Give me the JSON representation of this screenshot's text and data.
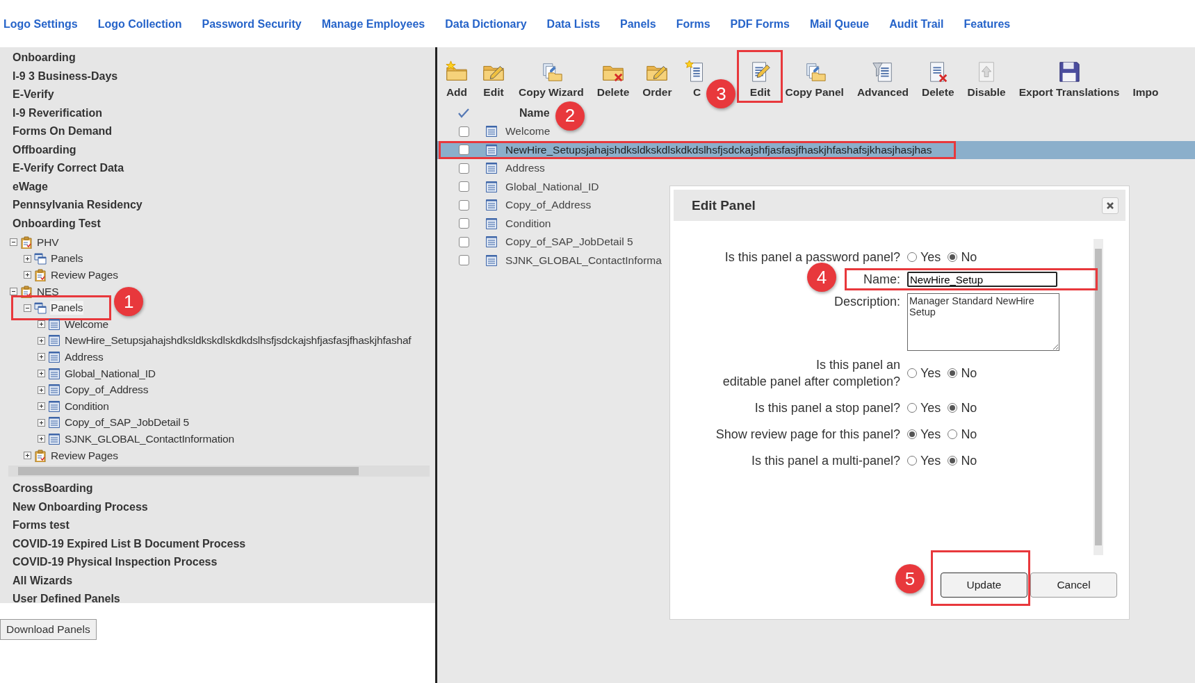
{
  "nav": [
    "Logo Settings",
    "Logo Collection",
    "Password Security",
    "Manage Employees",
    "Data Dictionary",
    "Data Lists",
    "Panels",
    "Forms",
    "PDF Forms",
    "Mail Queue",
    "Audit Trail",
    "Features"
  ],
  "sidebar": {
    "sections_top": [
      "Onboarding",
      "I-9 3 Business-Days",
      "E-Verify",
      "I-9 Reverification",
      "Forms On Demand",
      "Offboarding",
      "E-Verify Correct Data",
      "eWage",
      "Pennsylvania Residency",
      "Onboarding Test"
    ],
    "tree": [
      {
        "label": "PHV",
        "kind": "clipboard",
        "expanded": true,
        "selected": false,
        "children": [
          {
            "label": "Panels",
            "kind": "windows",
            "expanded": false,
            "selected": false
          },
          {
            "label": "Review Pages",
            "kind": "clipboard",
            "expanded": false,
            "selected": false
          }
        ]
      },
      {
        "label": "NES",
        "kind": "clipboard",
        "expanded": true,
        "selected": false,
        "children": [
          {
            "label": "Panels",
            "kind": "windows",
            "expanded": true,
            "selected": true,
            "callout": "1",
            "children": [
              {
                "label": "Welcome",
                "kind": "doc",
                "expanded": false,
                "selected": false
              },
              {
                "label": "NewHire_Setupsjahajshdksldkskdlskdkdslhsfjsdckajshfjasfasjfhaskjhfashaf",
                "kind": "doc",
                "expanded": false,
                "selected": false
              },
              {
                "label": "Address",
                "kind": "doc",
                "expanded": false,
                "selected": false
              },
              {
                "label": "Global_National_ID",
                "kind": "doc",
                "expanded": false,
                "selected": false
              },
              {
                "label": "Copy_of_Address",
                "kind": "doc",
                "expanded": false,
                "selected": false
              },
              {
                "label": "Condition",
                "kind": "doc",
                "expanded": false,
                "selected": false
              },
              {
                "label": "Copy_of_SAP_JobDetail 5",
                "kind": "doc",
                "expanded": false,
                "selected": false
              },
              {
                "label": "SJNK_GLOBAL_ContactInformation",
                "kind": "doc",
                "expanded": false,
                "selected": false
              }
            ]
          },
          {
            "label": "Review Pages",
            "kind": "clipboard",
            "expanded": false,
            "selected": false
          }
        ]
      }
    ],
    "sections_bottom": [
      "CrossBoarding",
      "New Onboarding Process",
      "Forms test",
      "COVID-19 Expired List B Document Process",
      "COVID-19 Physical Inspection Process",
      "All Wizards",
      "User Defined Panels"
    ],
    "download_button": "Download Panels"
  },
  "toolbar": [
    {
      "label": "Add",
      "kind": "folder-star"
    },
    {
      "label": "Edit",
      "kind": "folder-pencil"
    },
    {
      "label": "Copy Wizard",
      "kind": "folder-copy"
    },
    {
      "label": "Delete",
      "kind": "folder-x"
    },
    {
      "label": "Order",
      "kind": "folder-pencil"
    },
    {
      "label": "C",
      "kind": "doc-star"
    },
    {
      "label": "Edit",
      "kind": "doc-pencil",
      "callout": "3"
    },
    {
      "label": "Copy Panel",
      "kind": "folder-copy"
    },
    {
      "label": "Advanced",
      "kind": "doc-funnel"
    },
    {
      "label": "Delete",
      "kind": "doc-x"
    },
    {
      "label": "Disable",
      "kind": "doc-up"
    },
    {
      "label": "Export Translations",
      "kind": "floppy"
    },
    {
      "label": "Impo",
      "kind": "plain"
    }
  ],
  "panel_list": {
    "header": "Name",
    "rows": [
      {
        "name": "Welcome",
        "checked": false,
        "selected": false
      },
      {
        "name": "NewHire_Setupsjahajshdksldkskdlskdkdslhsfjsdckajshfjasfasjfhaskjhfashafsjkhasjhasjhas",
        "checked": false,
        "selected": true,
        "callout": "2"
      },
      {
        "name": "Address",
        "checked": false,
        "selected": false
      },
      {
        "name": "Global_National_ID",
        "checked": false,
        "selected": false
      },
      {
        "name": "Copy_of_Address",
        "checked": false,
        "selected": false
      },
      {
        "name": "Condition",
        "checked": false,
        "selected": false
      },
      {
        "name": "Copy_of_SAP_JobDetail 5",
        "checked": false,
        "selected": false
      },
      {
        "name": "SJNK_GLOBAL_ContactInforma",
        "checked": false,
        "selected": false
      }
    ]
  },
  "dialog": {
    "title": "Edit Panel",
    "fields": [
      {
        "kind": "radio",
        "label": [
          "Is this panel a password panel?"
        ],
        "options": [
          {
            "label": "Yes",
            "selected": false
          },
          {
            "label": "No",
            "selected": true
          }
        ]
      },
      {
        "kind": "text",
        "label": [
          "Name:"
        ],
        "value": "NewHire_Setup",
        "callout": "4"
      },
      {
        "kind": "textarea",
        "label": [
          "Description:"
        ],
        "value": "Manager Standard NewHire Setup"
      },
      {
        "kind": "radio",
        "label": [
          "Is this panel an",
          "editable panel after completion?"
        ],
        "options": [
          {
            "label": "Yes",
            "selected": false
          },
          {
            "label": "No",
            "selected": true
          }
        ]
      },
      {
        "kind": "radio",
        "label": [
          "Is this panel a stop panel?"
        ],
        "options": [
          {
            "label": "Yes",
            "selected": false
          },
          {
            "label": "No",
            "selected": true
          }
        ]
      },
      {
        "kind": "radio",
        "label": [
          "Show review page for this panel?"
        ],
        "options": [
          {
            "label": "Yes",
            "selected": true
          },
          {
            "label": "No",
            "selected": false
          }
        ]
      },
      {
        "kind": "radio",
        "label": [
          "Is this panel a multi-panel?"
        ],
        "options": [
          {
            "label": "Yes",
            "selected": false
          },
          {
            "label": "No",
            "selected": true
          }
        ]
      }
    ],
    "buttons": [
      {
        "label": "Update",
        "callout": "5"
      },
      {
        "label": "Cancel"
      }
    ]
  }
}
